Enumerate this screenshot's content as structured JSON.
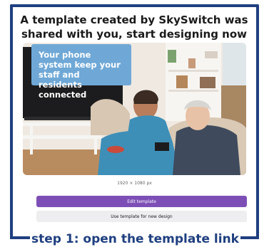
{
  "heading": "A template created by SkySwitch was shared with you, start designing now",
  "callout": "Your phone system keep your staff and residents connected",
  "dimensions": "1920 × 1080 px",
  "edit_button": "Edit template",
  "use_button": "Use template for new design",
  "step_caption": "step 1: open the template link",
  "colors": {
    "frame": "#1f3f7f",
    "edit_button": "#7d4fb6",
    "callout": "#6fa8d6"
  }
}
